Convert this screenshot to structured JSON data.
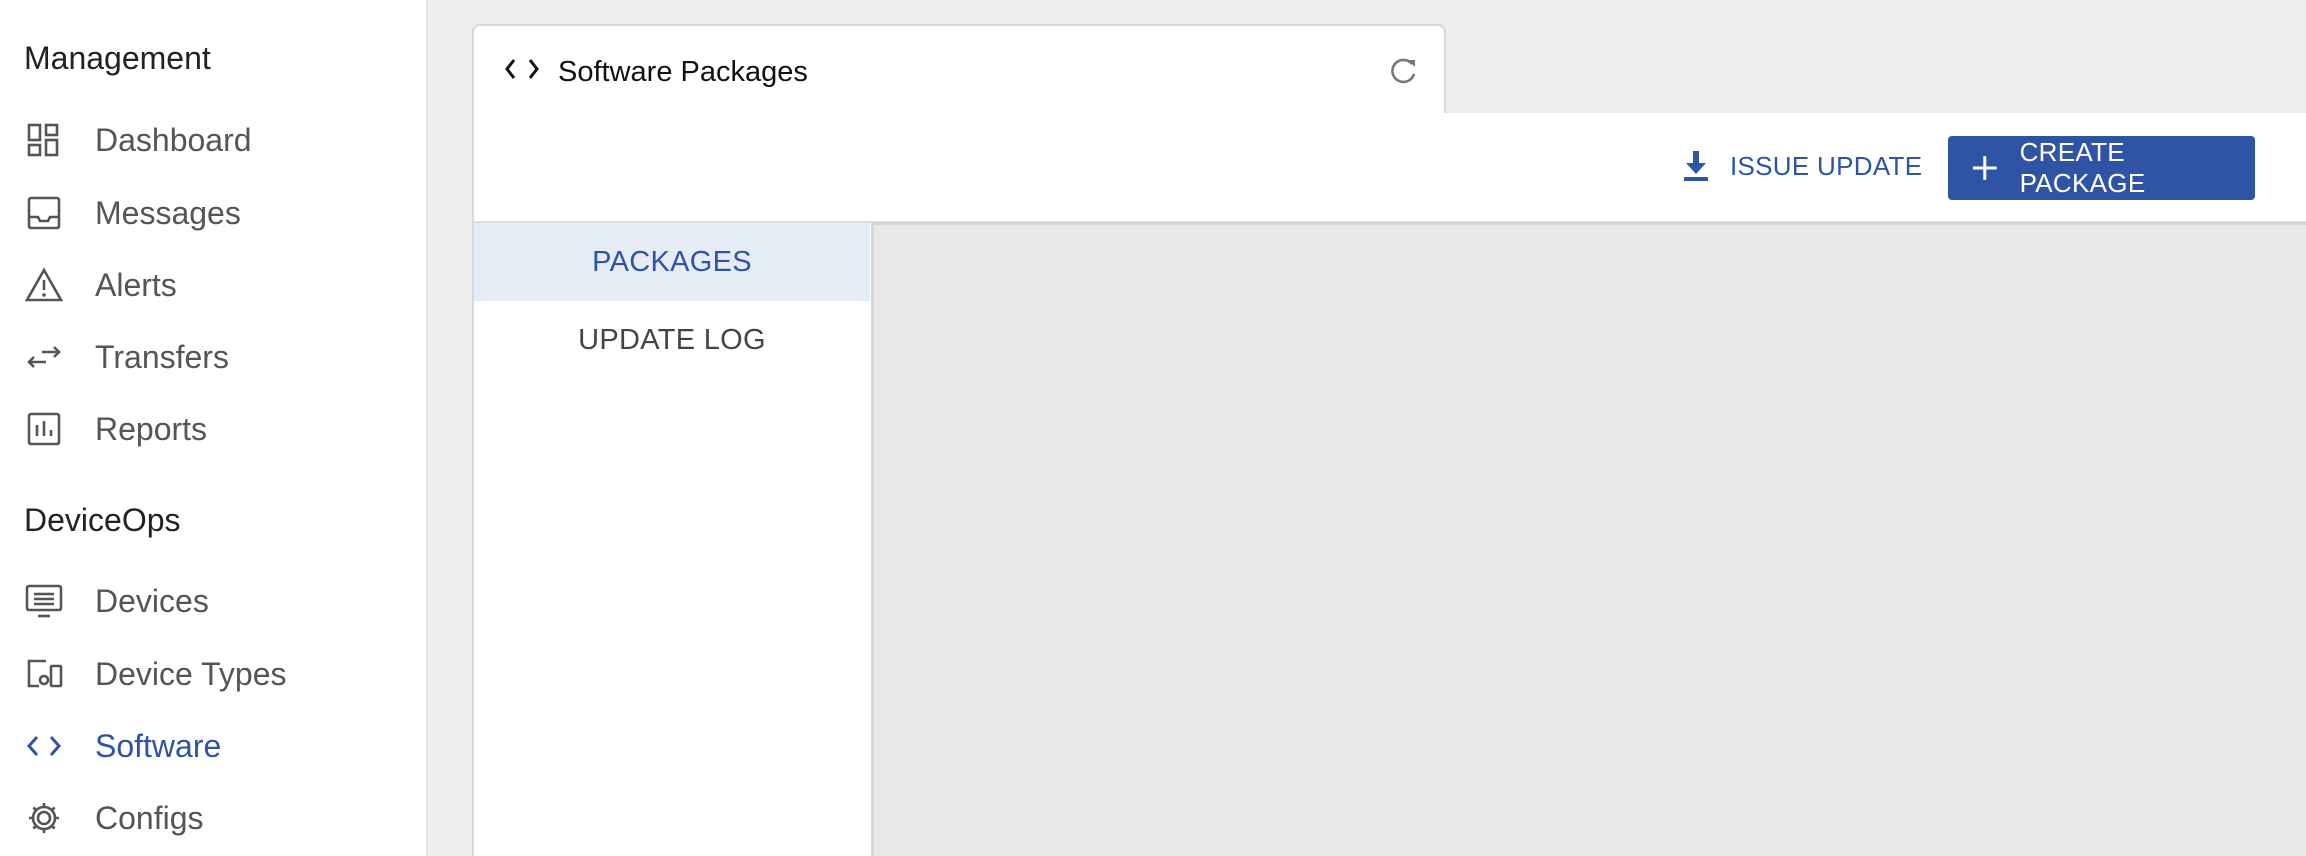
{
  "sidebar": {
    "sections": [
      {
        "title": "Management",
        "items": [
          {
            "label": "Dashboard",
            "icon": "dashboard-icon"
          },
          {
            "label": "Messages",
            "icon": "inbox-icon"
          },
          {
            "label": "Alerts",
            "icon": "warning-icon"
          },
          {
            "label": "Transfers",
            "icon": "transfer-icon"
          },
          {
            "label": "Reports",
            "icon": "report-icon"
          }
        ]
      },
      {
        "title": "DeviceOps",
        "items": [
          {
            "label": "Devices",
            "icon": "devices-icon"
          },
          {
            "label": "Device Types",
            "icon": "device-types-icon"
          },
          {
            "label": "Software",
            "icon": "code-icon",
            "active": true
          },
          {
            "label": "Configs",
            "icon": "gear-icon"
          }
        ]
      }
    ]
  },
  "panel": {
    "title": "Software Packages",
    "title_icon": "code-icon",
    "refresh_icon": "refresh-icon"
  },
  "toolbar": {
    "issue_update_label": "ISSUE UPDATE",
    "create_package_label": "CREATE PACKAGE"
  },
  "tabs": [
    {
      "label": "PACKAGES",
      "active": true
    },
    {
      "label": "UPDATE LOG",
      "active": false
    }
  ],
  "colors": {
    "accent": "#2f53a5",
    "active_tab_bg": "#e6ecf5",
    "content_bg": "#e9e9e9"
  }
}
